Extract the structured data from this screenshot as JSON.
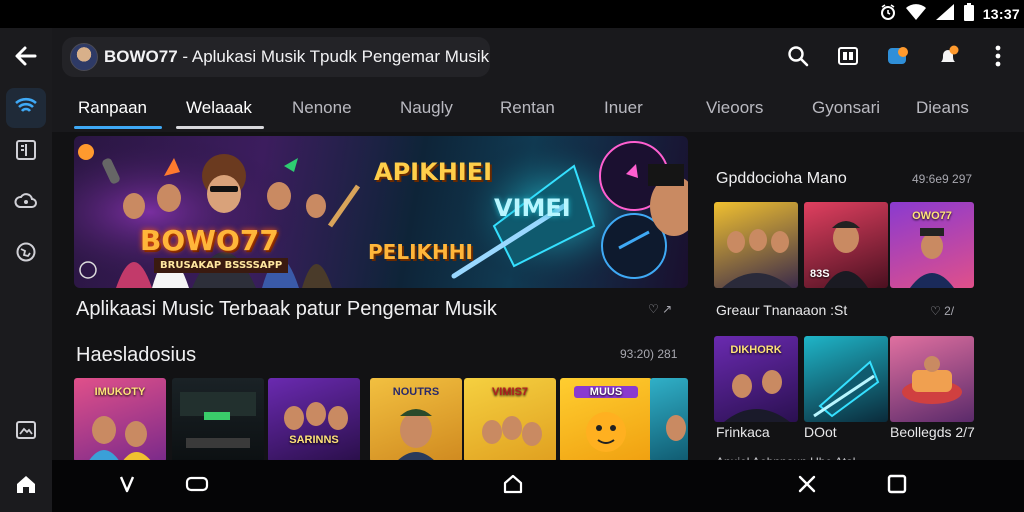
{
  "status_bar": {
    "time": "13:37",
    "icons": [
      "alarm-icon",
      "wifi-icon",
      "signal-icon",
      "battery-icon"
    ]
  },
  "app_bar": {
    "back_icon": "back-arrow-icon",
    "title_bold": "BOWO77",
    "title_rest": " - Aplukasi Musik Tpudk Pengemar Musik",
    "actions": [
      "search-icon",
      "cast-icon",
      "profile-icon",
      "notification-icon",
      "more-vert-icon"
    ]
  },
  "rail": {
    "items": [
      "wifi-home-icon",
      "library-icon",
      "cloud-icon",
      "globe-icon",
      "gallery-icon",
      "home-icon"
    ]
  },
  "tabs": [
    {
      "label": "Ranpaan",
      "active": true
    },
    {
      "label": "Welaaak",
      "active": false
    },
    {
      "label": "Nenone",
      "active": false
    },
    {
      "label": "Naugly",
      "active": false
    },
    {
      "label": "Rentan",
      "active": false
    },
    {
      "label": "Inuer",
      "active": false
    },
    {
      "label": "Vieoors",
      "active": false
    },
    {
      "label": "Gyonsari",
      "active": false
    },
    {
      "label": "Dieans",
      "active": false
    }
  ],
  "hero": {
    "brand": "BOWO77",
    "brand_sub": "BRUSAKAP BSSSSAPP",
    "right_title": "APIKHIEI",
    "right_word": "VIMEI",
    "right_small": "PELIKHHI",
    "caption": "Aplikaasi Music Terbaak patur Pengemar Musik",
    "meta": "♡ ↗"
  },
  "section": {
    "title": "Haesladosius",
    "meta": "93:20) 281"
  },
  "thumbnails": [
    {
      "label": "IMUKOTY"
    },
    {
      "label": ""
    },
    {
      "label": "SARINNS"
    },
    {
      "label": "NOUTRS"
    },
    {
      "label": "VIMIS7"
    },
    {
      "label": "MUUS"
    },
    {
      "label": ""
    }
  ],
  "right_panel": {
    "title": "Gpddocioha Mano",
    "meta": "49:6e9 297",
    "row1": [
      {
        "label": ""
      },
      {
        "label": "83S"
      },
      {
        "label": "OWO77"
      }
    ],
    "row1_caption": "Greaur Tnanaaon :St",
    "row1_meta": "♡ 2/",
    "row2": [
      {
        "label": "DIKHORK"
      },
      {
        "label": ""
      },
      {
        "label": ""
      }
    ],
    "row2_captions": [
      "Frinkaca",
      "DOot",
      "Beollegds 2/7"
    ],
    "cut_text": "Anuiel Aobnnaun Uhe Atal"
  },
  "nav_bar": {
    "buttons": [
      "back-v-icon",
      "recents-icon",
      "home-icon",
      "close-icon",
      "square-icon"
    ]
  },
  "colors": {
    "accent": "#3fa9f5",
    "background": "#121214",
    "orange_dot": "#ff9a2e"
  }
}
